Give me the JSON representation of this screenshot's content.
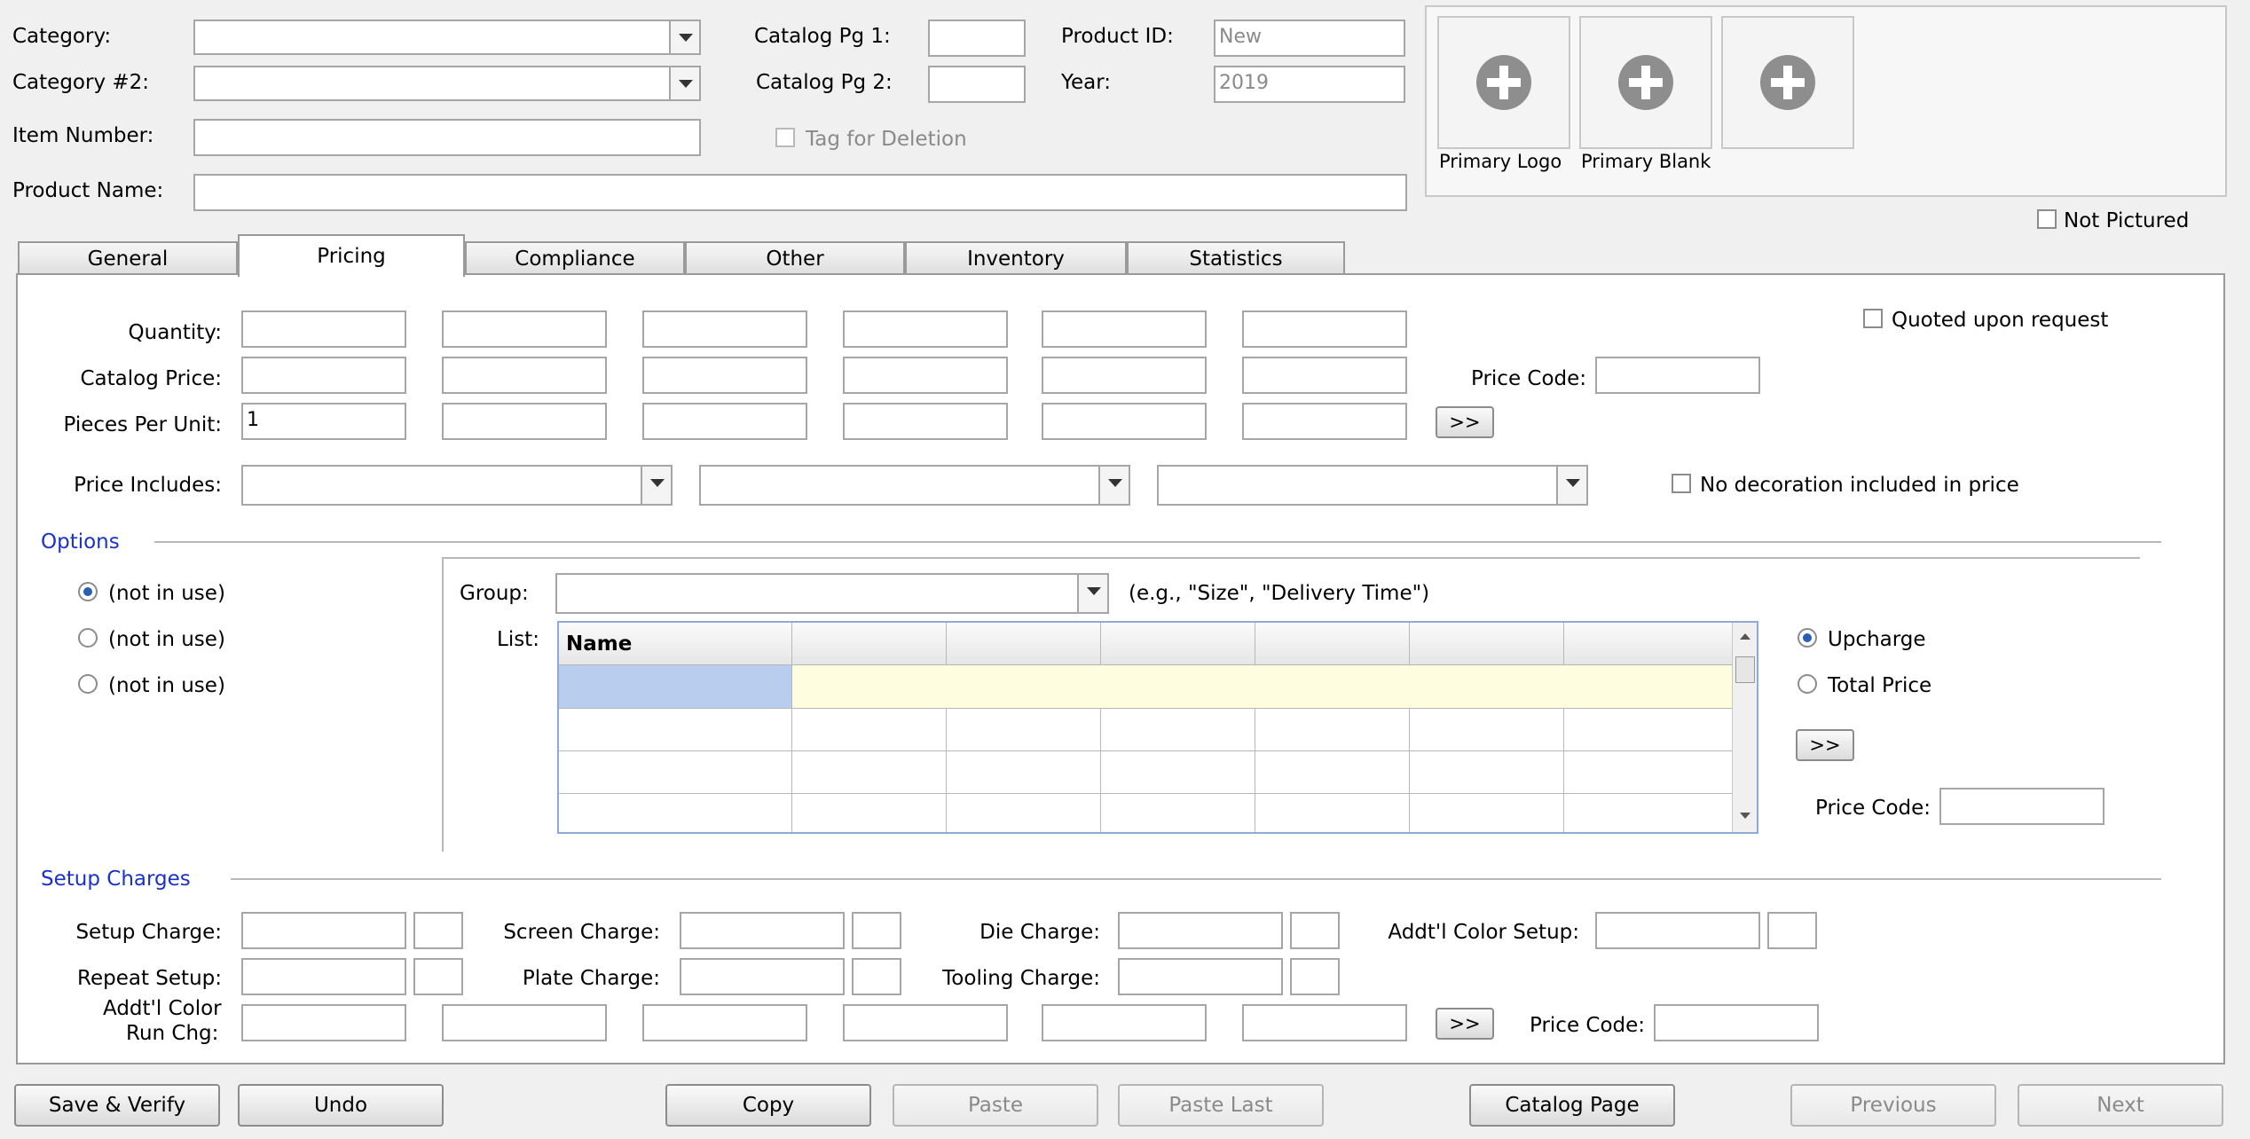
{
  "header": {
    "category_label": "Category:",
    "category2_label": "Category #2:",
    "item_number_label": "Item Number:",
    "product_name_label": "Product Name:",
    "catalog_pg1_label": "Catalog Pg 1:",
    "catalog_pg2_label": "Catalog Pg 2:",
    "tag_for_deletion_label": "Tag for Deletion",
    "product_id_label": "Product ID:",
    "product_id_value": "New",
    "year_label": "Year:",
    "year_value": "2019"
  },
  "images": {
    "primary_logo_label": "Primary Logo",
    "primary_blank_label": "Primary Blank",
    "not_pictured_label": "Not Pictured"
  },
  "tabs": [
    {
      "label": "General"
    },
    {
      "label": "Pricing"
    },
    {
      "label": "Compliance"
    },
    {
      "label": "Other"
    },
    {
      "label": "Inventory"
    },
    {
      "label": "Statistics"
    }
  ],
  "pricing": {
    "quantity_label": "Quantity:",
    "catalog_price_label": "Catalog Price:",
    "pieces_per_unit_label": "Pieces Per Unit:",
    "pieces_per_unit_first": "1",
    "price_code_label": "Price Code:",
    "more_button": ">>",
    "quoted_label": "Quoted upon request",
    "price_includes_label": "Price Includes:",
    "no_decoration_label": "No decoration included in price"
  },
  "options": {
    "section_label": "Options",
    "radios": [
      {
        "label": "(not in use)",
        "selected": true
      },
      {
        "label": "(not in use)",
        "selected": false
      },
      {
        "label": "(not in use)",
        "selected": false
      }
    ],
    "group_label": "Group:",
    "group_hint": "(e.g., \"Size\", \"Delivery Time\")",
    "list_label": "List:",
    "grid_name_header": "Name",
    "upcharge_label": "Upcharge",
    "total_price_label": "Total Price",
    "more_button": ">>",
    "price_code_label": "Price Code:"
  },
  "setup": {
    "section_label": "Setup Charges",
    "setup_charge_label": "Setup Charge:",
    "screen_charge_label": "Screen Charge:",
    "die_charge_label": "Die Charge:",
    "addtl_color_setup_label": "Addt'l Color Setup:",
    "repeat_setup_label": "Repeat Setup:",
    "plate_charge_label": "Plate Charge:",
    "tooling_charge_label": "Tooling Charge:",
    "addtl_color_run_label_1": "Addt'l Color",
    "addtl_color_run_label_2": "Run Chg:",
    "more_button": ">>",
    "price_code_label": "Price Code:"
  },
  "footer": {
    "save_verify": "Save & Verify",
    "undo": "Undo",
    "copy": "Copy",
    "paste": "Paste",
    "paste_last": "Paste Last",
    "catalog_page": "Catalog Page",
    "previous": "Previous",
    "next": "Next"
  },
  "colors": {
    "section_text": "#1a32c8",
    "grid_selected": "#b9cdee",
    "grid_row_highlight": "#fffde0"
  },
  "icons": {
    "image_slot": "plus-circle-icon"
  }
}
